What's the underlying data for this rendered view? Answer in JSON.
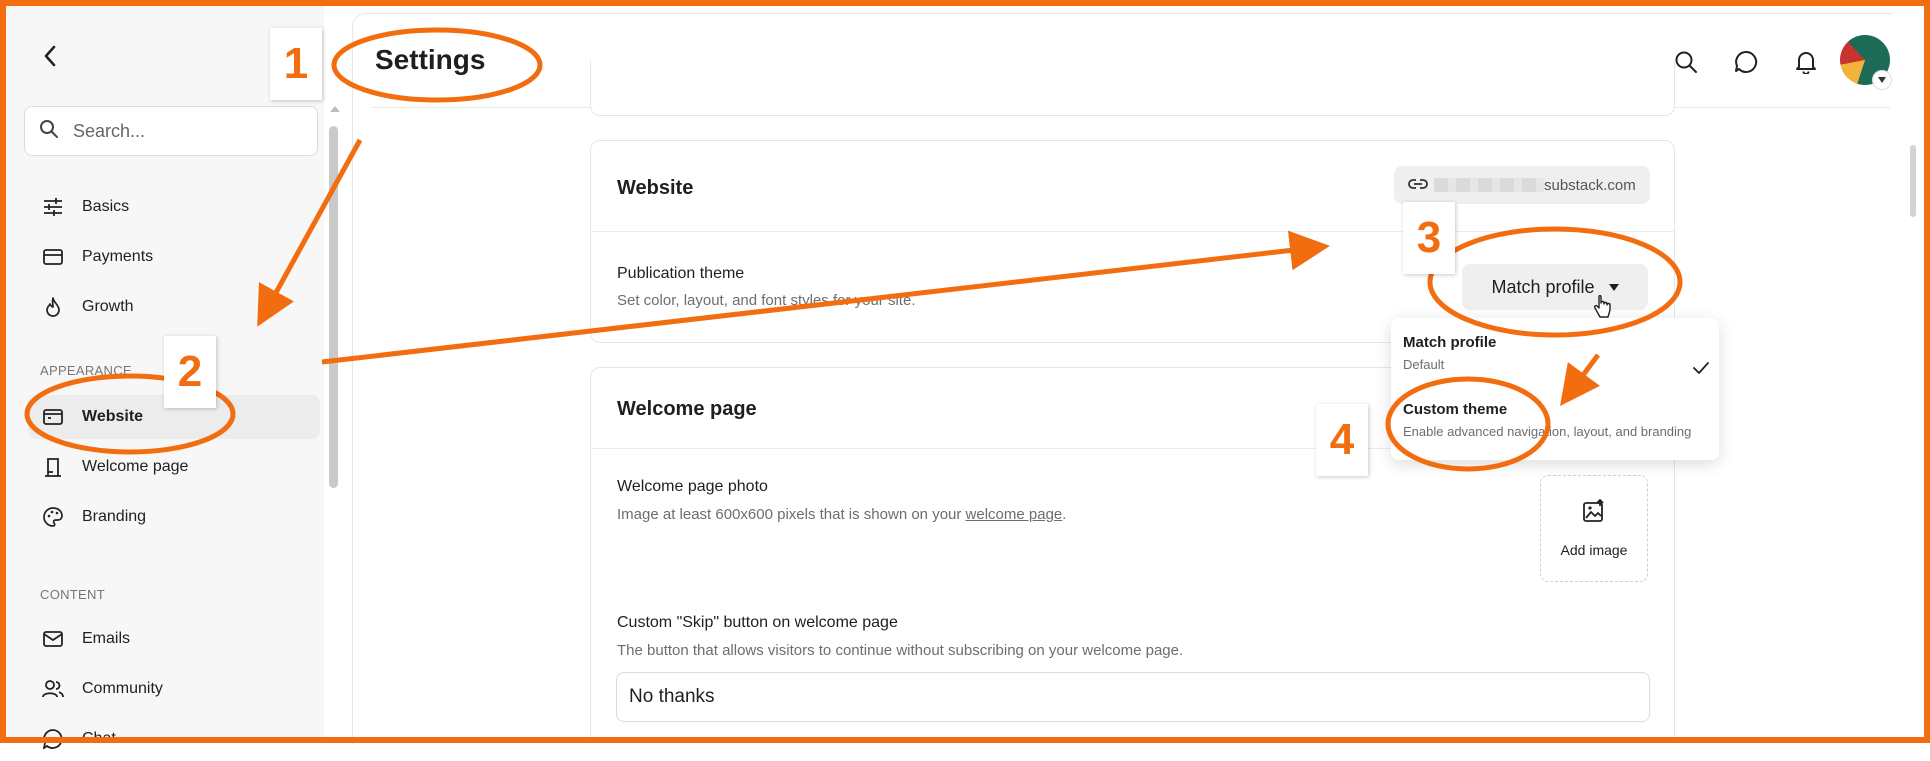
{
  "header": {
    "title": "Settings"
  },
  "search": {
    "placeholder": "Search..."
  },
  "sidebar": {
    "items": [
      {
        "label": "Basics",
        "icon": "sliders-icon"
      },
      {
        "label": "Payments",
        "icon": "credit-card-icon"
      },
      {
        "label": "Growth",
        "icon": "flame-icon"
      },
      {
        "label": "Website",
        "icon": "browser-window-icon",
        "active": true
      },
      {
        "label": "Welcome page",
        "icon": "doorway-icon"
      },
      {
        "label": "Branding",
        "icon": "palette-icon"
      },
      {
        "label": "Emails",
        "icon": "mail-icon"
      },
      {
        "label": "Community",
        "icon": "people-icon"
      },
      {
        "label": "Chat",
        "icon": "chat-icon"
      }
    ],
    "sections": {
      "appearance": "APPEARANCE",
      "content": "CONTENT"
    }
  },
  "website_card": {
    "title": "Website",
    "url_suffix": "substack.com",
    "theme_title": "Publication theme",
    "theme_desc": "Set color, layout, and font styles for your site.",
    "theme_button": "Match profile"
  },
  "theme_dropdown": {
    "options": [
      {
        "title": "Match profile",
        "subtitle": "Default",
        "selected": true
      },
      {
        "title": "Custom theme",
        "subtitle": "Enable advanced navigation, layout, and branding",
        "selected": false
      }
    ]
  },
  "welcome_card": {
    "title": "Welcome page",
    "photo_title": "Welcome page photo",
    "photo_desc_prefix": "Image at least 600x600 pixels that is shown on your ",
    "photo_desc_link": "welcome page",
    "photo_desc_suffix": ".",
    "add_image": "Add image",
    "skip_title": "Custom \"Skip\" button on welcome page",
    "skip_desc": "The button that allows visitors to continue without subscribing on your welcome page.",
    "skip_value": "No thanks"
  },
  "annotations": {
    "steps": [
      "1",
      "2",
      "3",
      "4"
    ],
    "color": "#f26d0f"
  },
  "colors": {
    "accent_orange": "#f26d0f",
    "active_nav_bg": "#ececec",
    "sidebar_bg": "#f7f7f7"
  }
}
